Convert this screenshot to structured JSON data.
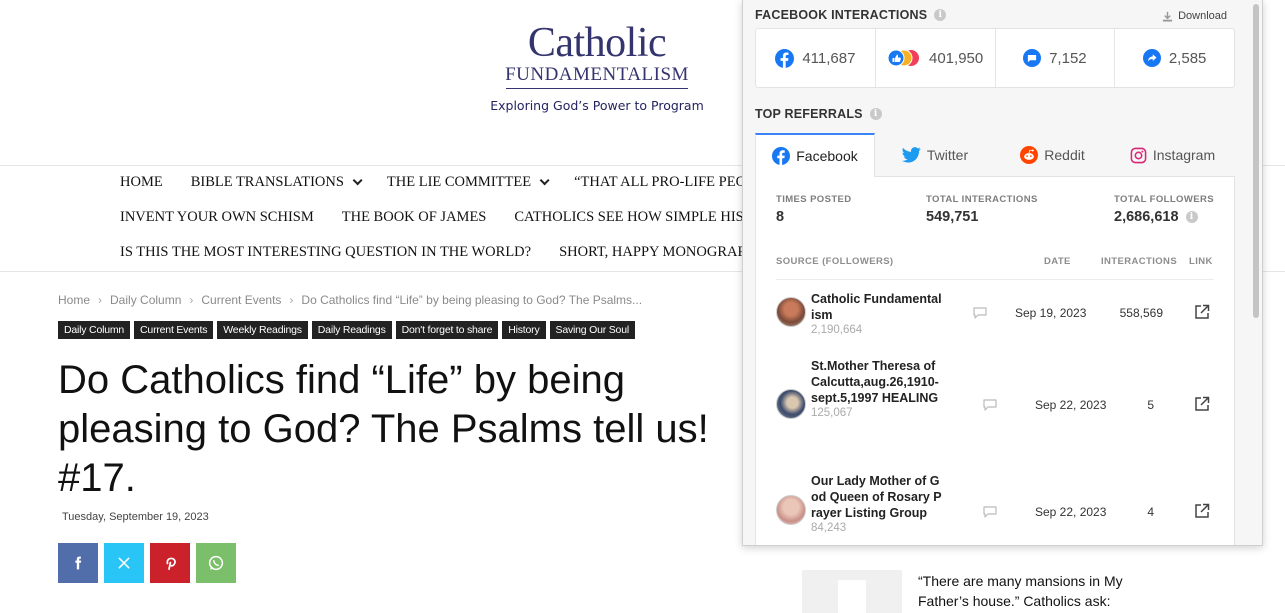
{
  "site": {
    "logo_title": "Catholic",
    "logo_sub": "FUNDAMENTALISM",
    "tagline": "Exploring God’s Power to Program"
  },
  "nav": {
    "row1": [
      {
        "label": "HOME",
        "dropdown": false
      },
      {
        "label": "BIBLE TRANSLATIONS",
        "dropdown": true
      },
      {
        "label": "THE LIE COMMITTEE",
        "dropdown": true
      },
      {
        "label": "“THAT ALL PRO-LIFE PEO",
        "dropdown": false
      }
    ],
    "row2": [
      {
        "label": "INVENT YOUR OWN SCHISM"
      },
      {
        "label": "THE BOOK OF JAMES"
      },
      {
        "label": "CATHOLICS SEE HOW SIMPLE HIST"
      }
    ],
    "row3": [
      {
        "label": "IS THIS THE MOST INTERESTING QUESTION IN THE WORLD?"
      },
      {
        "label": "SHORT, HAPPY MONOGRAP"
      }
    ]
  },
  "breadcrumb": [
    "Home",
    "Daily Column",
    "Current Events",
    "Do Catholics find “Life” by being pleasing to God? The Psalms..."
  ],
  "tags": [
    "Daily Column",
    "Current Events",
    "Weekly Readings",
    "Daily Readings",
    "Don't forget to share",
    "History",
    "Saving Our Soul"
  ],
  "article": {
    "title": "Do Catholics find “Life” by being pleasing to God? The Psalms tell us! #17.",
    "date": "Tuesday, September 19, 2023"
  },
  "share_buttons": [
    "facebook-icon",
    "x-icon",
    "pinterest-icon",
    "whatsapp-icon"
  ],
  "sidebar": {
    "post_title": "“There are many mansions in My Father’s house.”  Catholics ask:"
  },
  "panel": {
    "interactions_title": "FACEBOOK INTERACTIONS",
    "download_label": "Download",
    "counts": {
      "total": "411,687",
      "reactions": "401,950",
      "comments": "7,152",
      "shares": "2,585"
    },
    "referrals_title": "TOP REFERRALS",
    "tabs": [
      {
        "label": "Facebook",
        "icon": "facebook-icon",
        "active": true
      },
      {
        "label": "Twitter",
        "icon": "twitter-icon",
        "active": false
      },
      {
        "label": "Reddit",
        "icon": "reddit-icon",
        "active": false
      },
      {
        "label": "Instagram",
        "icon": "instagram-icon",
        "active": false
      }
    ],
    "stats": {
      "times_posted_label": "TIMES POSTED",
      "times_posted": "8",
      "total_interactions_label": "TOTAL INTERACTIONS",
      "total_interactions": "549,751",
      "total_followers_label": "TOTAL FOLLOWERS",
      "total_followers": "2,686,618"
    },
    "table_headers": {
      "source": "SOURCE (FOLLOWERS)",
      "date": "DATE",
      "interactions": "INTERACTIONS",
      "link": "LINK"
    },
    "rows": [
      {
        "name": "Catholic Fundamentalism",
        "followers": "2,190,664",
        "date": "Sep 19, 2023",
        "interactions": "558,569"
      },
      {
        "name": "St.Mother Theresa of Calcutta,aug.26,1910-sept.5,1997 HEALING",
        "followers": "125,067",
        "date": "Sep 22, 2023",
        "interactions": "5"
      },
      {
        "name": "Our Lady Mother of God Queen of Rosary Prayer Listing Group",
        "followers": "84,243",
        "date": "Sep 22, 2023",
        "interactions": "4"
      }
    ]
  },
  "colors": {
    "facebook_blue": "#1877f2",
    "twitter_blue": "#1d9bf0",
    "reddit_orange": "#ff4500",
    "instagram_pink": "#d62976",
    "tab_accent": "#3b82f6"
  }
}
